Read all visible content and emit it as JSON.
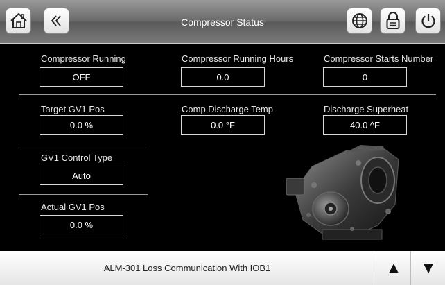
{
  "header": {
    "title": "Compressor Status"
  },
  "fields": {
    "compressor_running": {
      "label": "Compressor Running",
      "value": "OFF"
    },
    "running_hours": {
      "label": "Compressor Running Hours",
      "value": "0.0"
    },
    "starts_number": {
      "label": "Compressor Starts Number",
      "value": "0"
    },
    "target_gv1_pos": {
      "label": "Target GV1 Pos",
      "value": "0.0 %"
    },
    "discharge_temp": {
      "label": "Comp Discharge Temp",
      "value": "0.0 °F"
    },
    "discharge_superheat": {
      "label": "Discharge Superheat",
      "value": "40.0 ^F"
    },
    "gv1_control_type": {
      "label": "GV1 Control Type",
      "value": "Auto"
    },
    "actual_gv1_pos": {
      "label": "Actual GV1 Pos",
      "value": "0.0 %"
    }
  },
  "footer": {
    "alarm_text": "ALM-301 Loss Communication With IOB1",
    "up_label": "▲",
    "down_label": "▼"
  },
  "icons": [
    "home-icon",
    "double-chevron-left-icon",
    "globe-icon",
    "lock-icon",
    "power-icon"
  ]
}
